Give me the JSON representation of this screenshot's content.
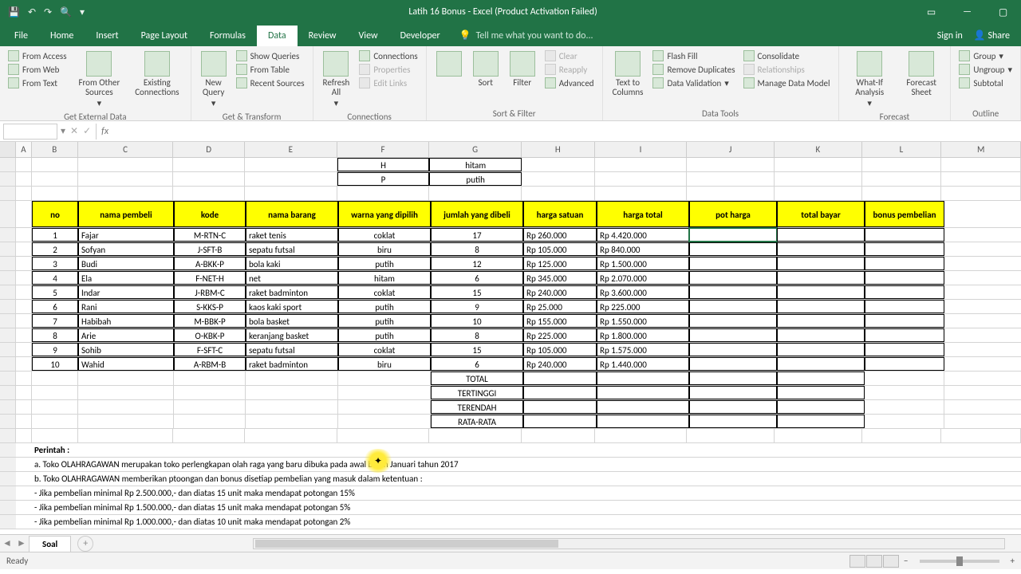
{
  "title": "Latih 16 Bonus - Excel (Product Activation Failed)",
  "tabs": [
    "File",
    "Home",
    "Insert",
    "Page Layout",
    "Formulas",
    "Data",
    "Review",
    "View",
    "Developer"
  ],
  "active_tab": "Data",
  "tellme": "Tell me what you want to do...",
  "signin": "Sign in",
  "share": "Share",
  "ribbon": {
    "g1": {
      "label": "Get External Data",
      "items": [
        "From Access",
        "From Web",
        "From Text"
      ],
      "other": "From Other Sources",
      "existing": "Existing Connections"
    },
    "g2": {
      "label": "Get & Transform",
      "new": "New Query",
      "show": "Show Queries",
      "table": "From Table",
      "recent": "Recent Sources"
    },
    "g3": {
      "label": "Connections",
      "refresh": "Refresh All",
      "conn": "Connections",
      "prop": "Properties",
      "edit": "Edit Links"
    },
    "g4": {
      "label": "Sort & Filter",
      "sort": "Sort",
      "filter": "Filter",
      "clear": "Clear",
      "reapply": "Reapply",
      "adv": "Advanced"
    },
    "g5": {
      "label": "Data Tools",
      "ttc": "Text to Columns",
      "flash": "Flash Fill",
      "dup": "Remove Duplicates",
      "val": "Data Validation",
      "cons": "Consolidate",
      "rel": "Relationships",
      "mdm": "Manage Data Model"
    },
    "g6": {
      "label": "Forecast",
      "wia": "What-If Analysis",
      "fs": "Forecast Sheet"
    },
    "g7": {
      "label": "Outline",
      "grp": "Group",
      "ung": "Ungroup",
      "sub": "Subtotal"
    }
  },
  "columns": [
    "A",
    "B",
    "C",
    "D",
    "E",
    "F",
    "G",
    "H",
    "I",
    "J",
    "K",
    "L",
    "M"
  ],
  "lookup": [
    [
      "H",
      "hitam"
    ],
    [
      "P",
      "putih"
    ]
  ],
  "headers": [
    "no",
    "nama pembeli",
    "kode",
    "nama barang",
    "warna yang dipilih",
    "jumlah yang dibeli",
    "harga satuan",
    "harga total",
    "pot harga",
    "total bayar",
    "bonus pembelian"
  ],
  "rows": [
    {
      "no": "1",
      "nama": "Fajar",
      "kode": "M-RTN-C",
      "barang": "raket tenis",
      "warna": "coklat",
      "jml": "17",
      "hrp": "Rp",
      "hs": "260.000",
      "trp": "Rp",
      "ht": "4.420.000"
    },
    {
      "no": "2",
      "nama": "Sofyan",
      "kode": "J-SFT-B",
      "barang": "sepatu futsal",
      "warna": "biru",
      "jml": "8",
      "hrp": "Rp",
      "hs": "105.000",
      "trp": "Rp",
      "ht": "840.000"
    },
    {
      "no": "3",
      "nama": "Budi",
      "kode": "A-BKK-P",
      "barang": "bola kaki",
      "warna": "putih",
      "jml": "12",
      "hrp": "Rp",
      "hs": "125.000",
      "trp": "Rp",
      "ht": "1.500.000"
    },
    {
      "no": "4",
      "nama": "Ela",
      "kode": "F-NET-H",
      "barang": "net",
      "warna": "hitam",
      "jml": "6",
      "hrp": "Rp",
      "hs": "345.000",
      "trp": "Rp",
      "ht": "2.070.000"
    },
    {
      "no": "5",
      "nama": "Indar",
      "kode": "J-RBM-C",
      "barang": "raket badminton",
      "warna": "coklat",
      "jml": "15",
      "hrp": "Rp",
      "hs": "240.000",
      "trp": "Rp",
      "ht": "3.600.000"
    },
    {
      "no": "6",
      "nama": "Rani",
      "kode": "S-KKS-P",
      "barang": "kaos kaki sport",
      "warna": "putih",
      "jml": "9",
      "hrp": "Rp",
      "hs": "25.000",
      "trp": "Rp",
      "ht": "225.000"
    },
    {
      "no": "7",
      "nama": "Habibah",
      "kode": "M-BBK-P",
      "barang": "bola basket",
      "warna": "putih",
      "jml": "10",
      "hrp": "Rp",
      "hs": "155.000",
      "trp": "Rp",
      "ht": "1.550.000"
    },
    {
      "no": "8",
      "nama": "Arie",
      "kode": "O-KBK-P",
      "barang": "keranjang basket",
      "warna": "putih",
      "jml": "8",
      "hrp": "Rp",
      "hs": "225.000",
      "trp": "Rp",
      "ht": "1.800.000"
    },
    {
      "no": "9",
      "nama": "Sohib",
      "kode": "F-SFT-C",
      "barang": "sepatu futsal",
      "warna": "coklat",
      "jml": "15",
      "hrp": "Rp",
      "hs": "105.000",
      "trp": "Rp",
      "ht": "1.575.000"
    },
    {
      "no": "10",
      "nama": "Wahid",
      "kode": "A-RBM-B",
      "barang": "raket badminton",
      "warna": "biru",
      "jml": "6",
      "hrp": "Rp",
      "hs": "240.000",
      "trp": "Rp",
      "ht": "1.440.000"
    }
  ],
  "summary": [
    "TOTAL",
    "TERTINGGI",
    "TERENDAH",
    "RATA-RATA"
  ],
  "perintah": {
    "title": "Perintah :",
    "a": "a. Toko OLAHRAGAWAN merupakan toko perlengkapan olah raga yang baru dibuka pada awal bulan Januari tahun 2017",
    "b": "b. Toko OLAHRAGAWAN memberikan ptoongan dan bonus disetiap pembelian yang masuk dalam ketentuan :",
    "b1": "   - Jika pembelian minimal Rp 2.500.000,- dan diatas 15 unit maka mendapat potongan 15%",
    "b2": "   - Jika pembelian minimal Rp 1.500.000,- dan diatas 15 unit maka mendapat potongan 5%",
    "b3": "   - Jika pembelian minimal Rp 1.000.000,- dan diatas 10 unit maka mendapat potongan 2%"
  },
  "sheet": "Soal",
  "status": "Ready"
}
